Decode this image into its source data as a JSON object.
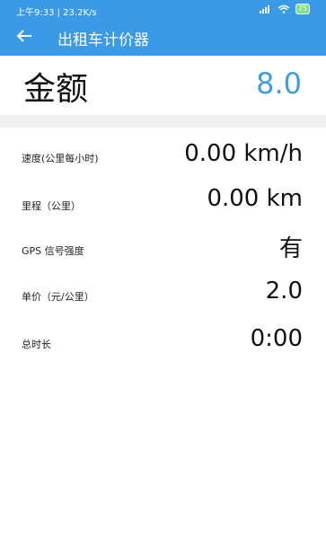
{
  "status_bar": {
    "left_text": "上午9:33 | 23.2K/s",
    "battery": "75"
  },
  "header": {
    "title": "出租车计价器"
  },
  "fare": {
    "label": "金额",
    "value": "8.0"
  },
  "details": [
    {
      "label": "速度(公里每小时)",
      "value": "0.00 km/h"
    },
    {
      "label": "里程（公里）",
      "value": "0.00 km"
    },
    {
      "label": "GPS 信号强度",
      "value": "有"
    },
    {
      "label": "单价（元/公里）",
      "value": "2.0"
    },
    {
      "label": "总时长",
      "value": "0:00"
    }
  ],
  "colors": {
    "header": "#3b9ae8",
    "fare_value": "#3f9ede"
  },
  "icons": {
    "back": "back-arrow-icon",
    "signal": "signal-icon",
    "wifi": "wifi-icon",
    "battery": "battery-icon"
  }
}
